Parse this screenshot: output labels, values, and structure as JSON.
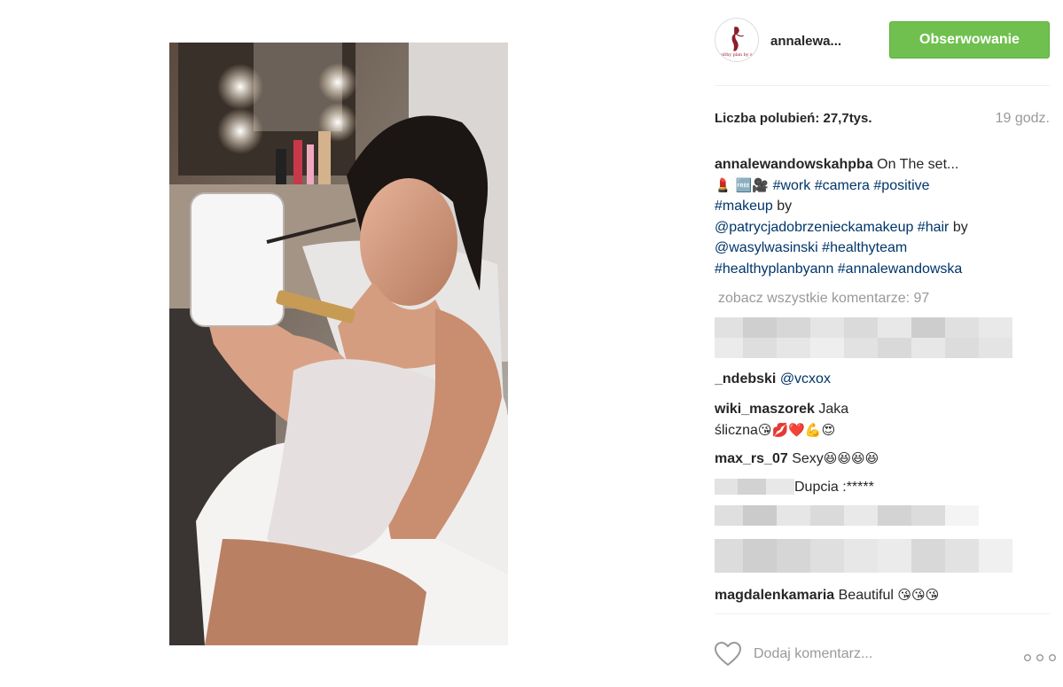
{
  "post": {
    "username_short": "annalewa...",
    "follow_label": "Obserwowanie",
    "likes": "Liczba polubień: 27,7tys.",
    "time_ago": "19 godz.",
    "caption": {
      "user": "annalewandowskahpba",
      "text": " On The set...",
      "emoji_line": "💄 🆓🎥 ",
      "tags_1": "#work #camera #positive",
      "tags_2": "#makeup",
      "by_1": " by",
      "mention_1": "@patrycjadobrzenieckamakeup",
      "tag_hair": " #hair",
      "by_2": " by",
      "mention_2": "@wasylwasinski",
      "tag_team": " #healthyteam",
      "tags_3": "#healthyplanbyann #annalewandowska"
    },
    "view_all_comments": "zobacz wszystkie komentarze: 97",
    "comments": [
      {
        "user": "_ndebski",
        "text": " ",
        "mention": "@vcxox"
      },
      {
        "user": "wiki_maszorek",
        "text": " Jaka",
        "text2": "śliczna",
        "emoji": "😘💋❤️💪😍"
      },
      {
        "user": "max_rs_07",
        "text": " Sexy",
        "emoji": "😆😆😆😆"
      },
      {
        "user": "",
        "text": "Dupcia :*****"
      },
      {
        "user": "magdalenkamaria",
        "text": " Beautiful ",
        "emoji": "😘😘😘"
      }
    ],
    "add_comment_placeholder": "Dodaj komentarz...",
    "more_icon": "more-dots-icon",
    "like_icon": "heart-icon"
  },
  "colors": {
    "follow_green": "#70c050",
    "link_blue": "#003569",
    "muted_gray": "#999999",
    "text_dark": "#262626"
  }
}
